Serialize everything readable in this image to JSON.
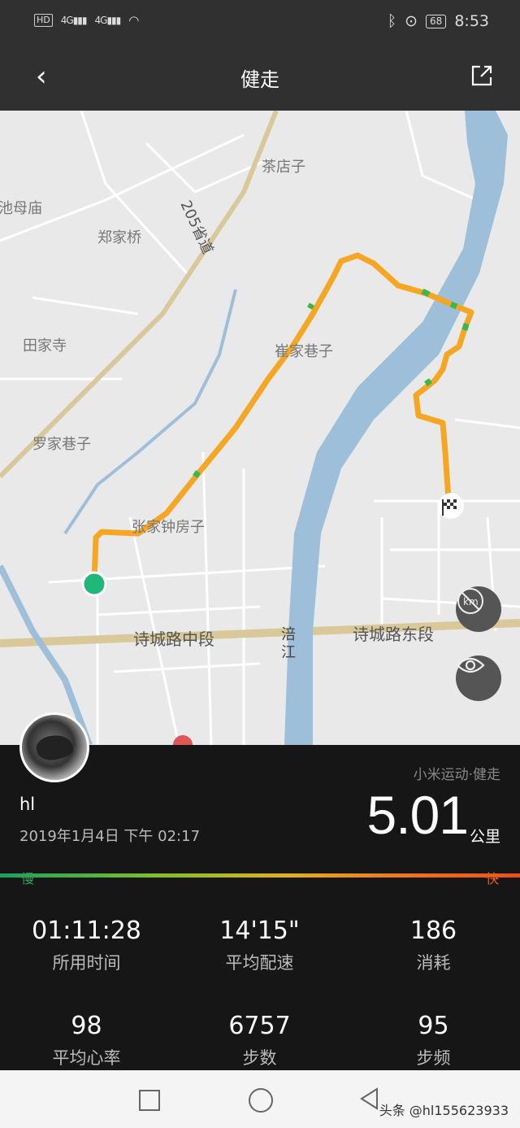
{
  "status_bar": {
    "hd": "HD",
    "sim1": "4G",
    "sim2": "4G",
    "battery": "68",
    "time": "8:53"
  },
  "header": {
    "title": "健走"
  },
  "map": {
    "places": [
      "茶店子",
      "池母庙",
      "郑家桥",
      "田家寺",
      "罗家巷子",
      "张家钟房子",
      "崔家巷子",
      "205省道",
      "涪",
      "江"
    ],
    "roads": [
      "诗城路中段",
      "诗城路东段"
    ]
  },
  "summary": {
    "source": "小米运动·健走",
    "username": "hl",
    "datetime": "2019年1月4日 下午 02:17",
    "distance": "5.01",
    "distance_unit": "公里",
    "slow_label": "慢",
    "fast_label": "快"
  },
  "stats": [
    {
      "value": "01:11:28",
      "label": "所用时间"
    },
    {
      "value": "14'15\"",
      "label": "平均配速"
    },
    {
      "value": "186",
      "label": "消耗"
    },
    {
      "value": "98",
      "label": "平均心率"
    },
    {
      "value": "6757",
      "label": "步数"
    },
    {
      "value": "95",
      "label": "步频"
    }
  ],
  "watermark": "头条 @hl155623933"
}
